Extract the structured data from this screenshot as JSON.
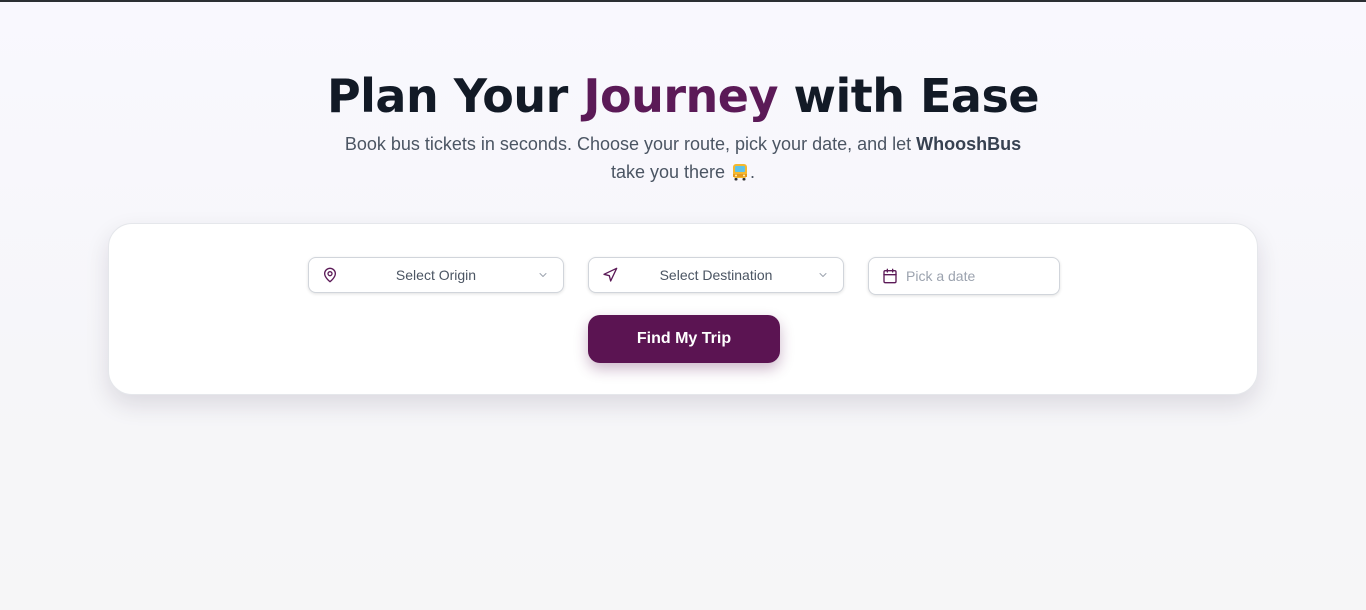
{
  "hero": {
    "title_before": "Plan Your ",
    "title_accent": "Journey",
    "title_after": " with Ease",
    "subtitle_before": "Book bus tickets in seconds. Choose your route, pick your date, and let ",
    "subtitle_brand": "WhooshBus",
    "subtitle_after": " take you there ",
    "subtitle_end": "."
  },
  "search": {
    "origin_placeholder": "Select Origin",
    "destination_placeholder": "Select Destination",
    "date_placeholder": "Pick a date",
    "submit_label": "Find My Trip"
  },
  "icons": {
    "origin": "map-pin-icon",
    "destination": "navigation-arrow-icon",
    "date": "calendar-icon",
    "dropdown": "chevron-down-icon",
    "subtitle_emoji": "bus-icon"
  },
  "colors": {
    "accent": "#5b1a57",
    "button": "#5b1452",
    "heading": "#121a26"
  }
}
